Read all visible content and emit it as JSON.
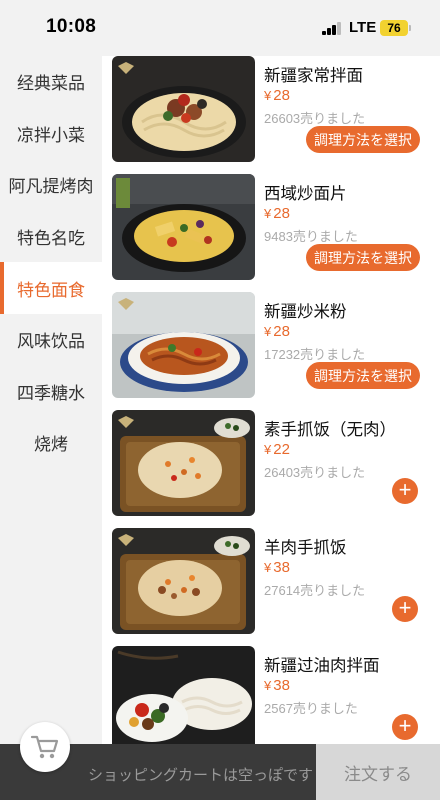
{
  "status_bar": {
    "time": "10:08",
    "network": "LTE",
    "battery": "76"
  },
  "categories": [
    {
      "label": "经典菜品"
    },
    {
      "label": "凉拌小菜"
    },
    {
      "label": "阿凡提烤肉"
    },
    {
      "label": "特色名吃"
    },
    {
      "label": "特色面食"
    },
    {
      "label": "风味饮品"
    },
    {
      "label": "四季糖水"
    },
    {
      "label": "烧烤"
    }
  ],
  "active_category": "特色面食",
  "currency": "¥",
  "products": [
    {
      "name": "新疆家常拌面",
      "price": "28",
      "sold": "26603売りました",
      "action": "調理方法を選択",
      "action_type": "select"
    },
    {
      "name": "西域炒面片",
      "price": "28",
      "sold": "9483売りました",
      "action": "調理方法を選択",
      "action_type": "select"
    },
    {
      "name": "新疆炒米粉",
      "price": "28",
      "sold": "17232売りました",
      "action": "調理方法を選択",
      "action_type": "select"
    },
    {
      "name": "素手抓饭（无肉）",
      "price": "22",
      "sold": "26403売りました",
      "action": "+",
      "action_type": "add"
    },
    {
      "name": "羊肉手抓饭",
      "price": "38",
      "sold": "27614売りました",
      "action": "+",
      "action_type": "add"
    },
    {
      "name": "新疆过油肉拌面",
      "price": "38",
      "sold": "2567売りました",
      "action": "+",
      "action_type": "add"
    }
  ],
  "cart": {
    "empty_message": "ショッピングカートは空っぽです",
    "checkout_label": "注文する"
  },
  "colors": {
    "accent": "#e86a2e",
    "bottom_bar": "#3a3a3a",
    "checkout_disabled": "#d7d7d7"
  },
  "icons": {
    "cart": "shopping-cart-icon",
    "add": "plus-icon"
  }
}
